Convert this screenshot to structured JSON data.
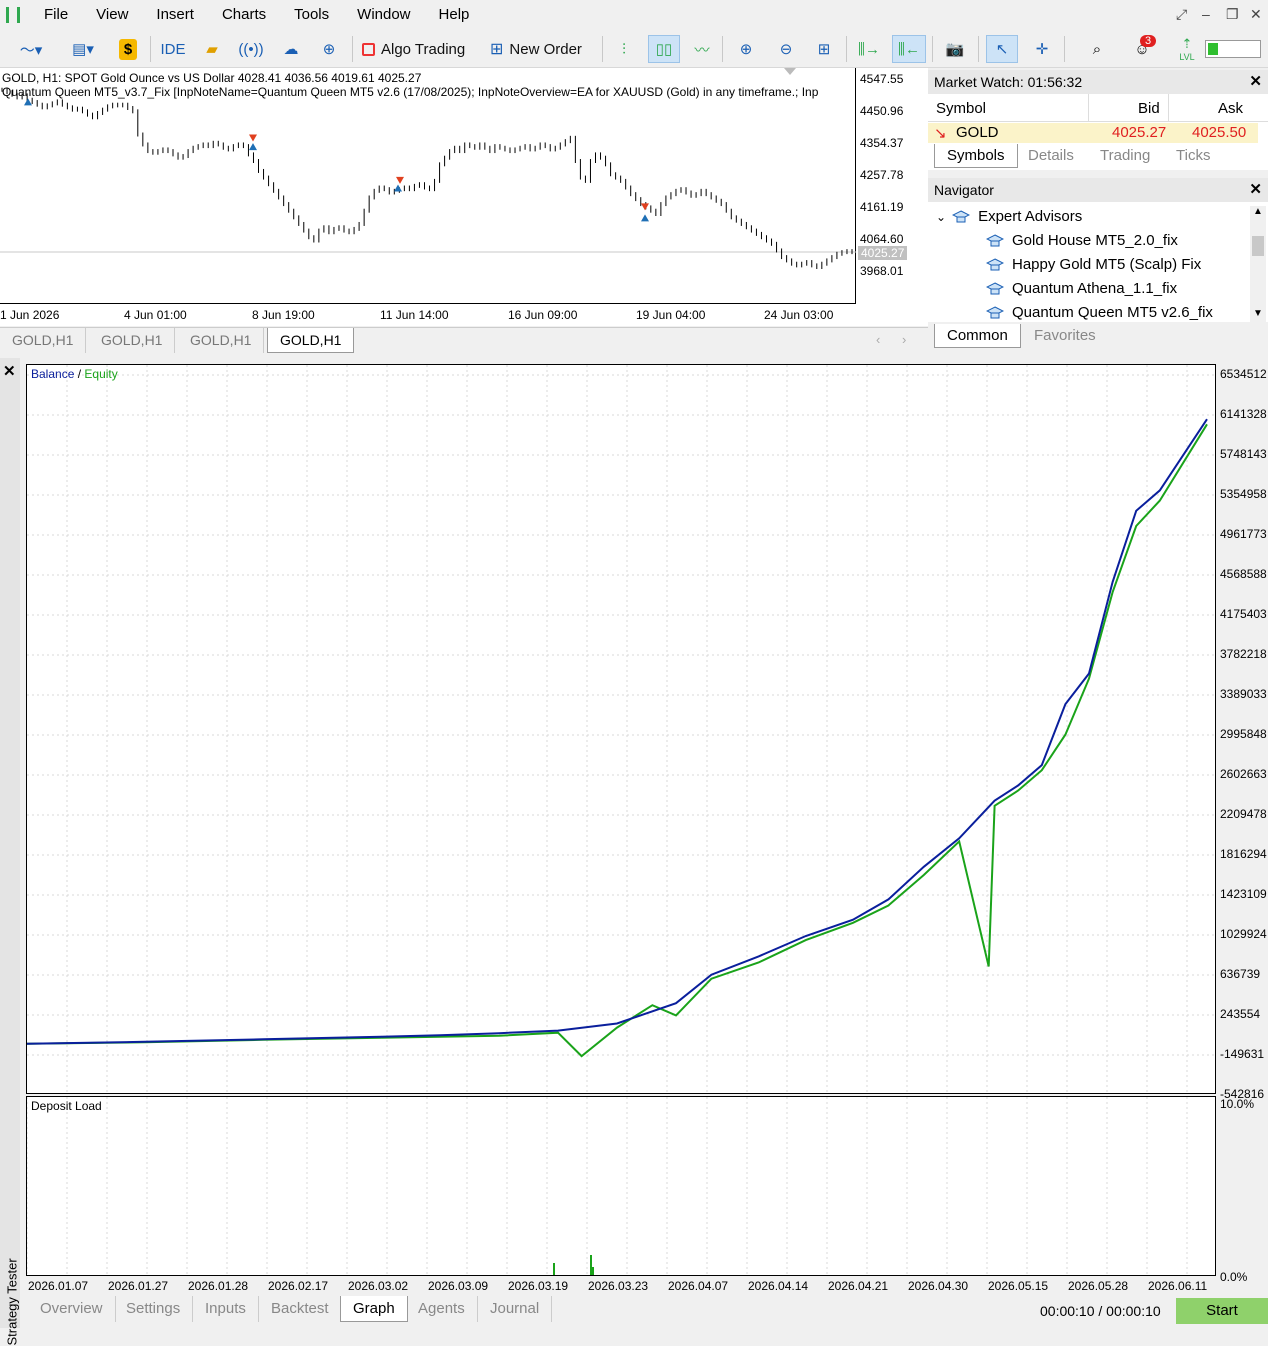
{
  "menu": {
    "items": [
      "File",
      "View",
      "Insert",
      "Charts",
      "Tools",
      "Window",
      "Help"
    ]
  },
  "toolbar": {
    "ide_label": "IDE",
    "algo_trading_label": "Algo Trading",
    "new_order_label": "New Order",
    "notification_count": "3",
    "lvl_label": "LVL"
  },
  "price_chart": {
    "info_line1": "GOLD, H1:  SPOT Gold Ounce vs US Dollar  4028.41 4036.56 4019.61 4025.27",
    "info_line2": "Quantum Queen MT5_v3.7_Fix [InpNoteName=Quantum Queen MT5 v2.6 (17/08/2025); InpNoteOverview=EA for XAUUSD (Gold) in any timeframe.; Inp",
    "price_labels": [
      "4547.55",
      "4450.96",
      "4354.37",
      "4257.78",
      "4161.19",
      "4064.60",
      "3968.01"
    ],
    "current_price": "4025.27",
    "time_labels": [
      "1 Jun 2026",
      "4 Jun 01:00",
      "8 Jun 19:00",
      "11 Jun 14:00",
      "16 Jun 09:00",
      "19 Jun 04:00",
      "24 Jun 03:00"
    ],
    "closes": [
      4515,
      4508,
      4500,
      4492,
      4498,
      4485,
      4478,
      4470,
      4462,
      4468,
      4474,
      4480,
      4470,
      4462,
      4455,
      4458,
      4450,
      4440,
      4432,
      4445,
      4455,
      4465,
      4470,
      4468,
      4470,
      4460,
      4450,
      4380,
      4350,
      4330,
      4325,
      4330,
      4335,
      4330,
      4320,
      4310,
      4315,
      4330,
      4340,
      4345,
      4350,
      4345,
      4355,
      4350,
      4340,
      4335,
      4345,
      4350,
      4345,
      4320,
      4300,
      4270,
      4250,
      4230,
      4210,
      4190,
      4170,
      4150,
      4130,
      4110,
      4090,
      4070,
      4060,
      4090,
      4100,
      4085,
      4095,
      4100,
      4090,
      4085,
      4095,
      4110,
      4150,
      4190,
      4210,
      4220,
      4215,
      4205,
      4210,
      4215,
      4220,
      4215,
      4225,
      4230,
      4220,
      4215,
      4240,
      4290,
      4310,
      4330,
      4340,
      4330,
      4350,
      4345,
      4340,
      4350,
      4340,
      4330,
      4345,
      4340,
      4335,
      4330,
      4335,
      4340,
      4345,
      4335,
      4340,
      4350,
      4345,
      4335,
      4340,
      4350,
      4360,
      4370,
      4300,
      4250,
      4240,
      4300,
      4320,
      4310,
      4290,
      4260,
      4250,
      4240,
      4220,
      4200,
      4185,
      4170,
      4160,
      4150,
      4140,
      4170,
      4190,
      4200,
      4210,
      4215,
      4205,
      4195,
      4200,
      4210,
      4200,
      4190,
      4180,
      4170,
      4150,
      4130,
      4120,
      4110,
      4100,
      4090,
      4080,
      4070,
      4060,
      4050,
      4030,
      4010,
      4000,
      3990,
      3985,
      3990,
      3995,
      3985,
      3980,
      3990,
      4000,
      4010,
      4020,
      4025,
      4028,
      4025
    ],
    "chart_tabs": [
      "GOLD,H1",
      "GOLD,H1",
      "GOLD,H1",
      "GOLD,H1"
    ]
  },
  "market_watch": {
    "title": "Market Watch: 01:56:32",
    "col_symbol": "Symbol",
    "col_bid": "Bid",
    "col_ask": "Ask",
    "row": {
      "symbol": "GOLD",
      "bid": "4025.27",
      "ask": "4025.50"
    },
    "tabs": [
      "Symbols",
      "Details",
      "Trading",
      "Ticks"
    ]
  },
  "navigator": {
    "title": "Navigator",
    "root": "Expert Advisors",
    "items": [
      "Gold House MT5_2.0_fix",
      "Happy Gold MT5 (Scalp) Fix",
      "Quantum Athena_1.1_fix",
      "Quantum Queen MT5 v2.6_fix"
    ],
    "tabs": [
      "Common",
      "Favorites"
    ]
  },
  "tester": {
    "side_label": "Strategy Tester",
    "legend_balance": "Balance",
    "legend_sep": " / ",
    "legend_equity": "Equity",
    "y_labels": [
      "6534512",
      "6141328",
      "5748143",
      "5354958",
      "4961773",
      "4568588",
      "4175403",
      "3782218",
      "3389033",
      "2995848",
      "2602663",
      "2209478",
      "1816294",
      "1423109",
      "1029924",
      "636739",
      "243554",
      "-149631",
      "-542816"
    ],
    "deposit_title": "Deposit Load",
    "deposit_y_labels": [
      "10.0%",
      "0.0%"
    ],
    "x_labels": [
      "2026.01.07",
      "2026.01.27",
      "2026.01.28",
      "2026.02.17",
      "2026.03.02",
      "2026.03.09",
      "2026.03.19",
      "2026.03.23",
      "2026.04.07",
      "2026.04.14",
      "2026.04.21",
      "2026.04.30",
      "2026.05.15",
      "2026.05.28",
      "2026.06.11"
    ],
    "tabs": [
      "Overview",
      "Settings",
      "Inputs",
      "Backtest",
      "Graph",
      "Agents",
      "Journal"
    ],
    "elapsed": "00:00:10 / 00:00:10",
    "start_label": "Start",
    "colors": {
      "balance": "#0a1f9c",
      "equity": "#1aa31a"
    }
  },
  "chart_data": {
    "type": "line",
    "title": "",
    "series": [
      {
        "name": "Balance",
        "x": [
          0,
          0.1,
          0.2,
          0.3,
          0.35,
          0.4,
          0.45,
          0.5,
          0.55,
          0.58,
          0.62,
          0.66,
          0.7,
          0.73,
          0.76,
          0.79,
          0.82,
          0.84,
          0.86,
          0.88,
          0.9,
          0.92,
          0.94,
          0.96,
          1.0
        ],
        "values": [
          -40000,
          -20000,
          5000,
          30000,
          45000,
          65000,
          90000,
          160000,
          360000,
          640000,
          820000,
          1020000,
          1180000,
          1380000,
          1700000,
          1980000,
          2350000,
          2500000,
          2700000,
          3300000,
          3600000,
          4500000,
          5200000,
          5400000,
          6100000
        ]
      },
      {
        "name": "Equity",
        "x": [
          0,
          0.1,
          0.2,
          0.3,
          0.35,
          0.4,
          0.45,
          0.47,
          0.5,
          0.53,
          0.55,
          0.58,
          0.62,
          0.66,
          0.7,
          0.73,
          0.76,
          0.79,
          0.815,
          0.82,
          0.84,
          0.86,
          0.88,
          0.9,
          0.92,
          0.94,
          0.96,
          1.0
        ],
        "values": [
          -40000,
          -25000,
          0,
          20000,
          30000,
          40000,
          70000,
          -160000,
          120000,
          340000,
          240000,
          600000,
          760000,
          980000,
          1150000,
          1320000,
          1620000,
          1950000,
          720000,
          2300000,
          2450000,
          2650000,
          3000000,
          3550000,
          4400000,
          5050000,
          5300000,
          6050000
        ]
      }
    ],
    "xlabel": "",
    "ylabel": "",
    "ylim": [
      -542816,
      6534512
    ]
  }
}
